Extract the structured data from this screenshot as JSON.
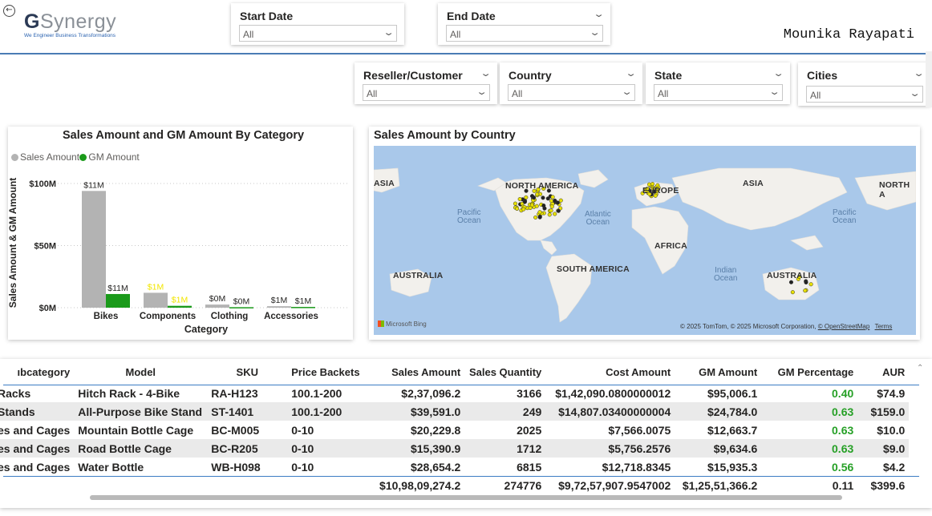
{
  "header": {
    "logo_initial": "G",
    "logo_rest": "Synergy",
    "logo_tagline": "We Engineer Business Transformations",
    "user_name": "Mounika Rayapati",
    "back_icon": "←"
  },
  "filters": {
    "start_date": {
      "title": "Start Date",
      "value": "All"
    },
    "end_date": {
      "title": "End Date",
      "value": "All"
    },
    "reseller": {
      "title": "Reseller/Customer",
      "value": "All"
    },
    "country": {
      "title": "Country",
      "value": "All"
    },
    "state": {
      "title": "State",
      "value": "All"
    },
    "cities": {
      "title": "Cities",
      "value": "All"
    }
  },
  "category_chart": {
    "title": "Sales Amount and GM Amount By Category",
    "legend": [
      {
        "name": "Sales Amount",
        "color": "#b3b3b3"
      },
      {
        "name": "GM Amount",
        "color": "#1a9a1a"
      }
    ],
    "xlabel": "Category",
    "ylabel": "Sales Amount & GM Amount",
    "y_ticks": [
      "$100M",
      "$50M",
      "$0M"
    ]
  },
  "chart_data": {
    "type": "bar",
    "categories": [
      "Bikes",
      "Components",
      "Clothing",
      "Accessories"
    ],
    "series": [
      {
        "name": "Sales Amount",
        "values": [
          94,
          12,
          2.5,
          1.2
        ],
        "labels": [
          "$11M",
          "$1M",
          "$0M",
          "$1M"
        ],
        "color": "#b3b3b3"
      },
      {
        "name": "GM Amount",
        "values": [
          11,
          1.5,
          0.4,
          0.6
        ],
        "labels": [
          "$11M",
          "$1M",
          "$0M",
          "$1M"
        ],
        "color": "#1a9a1a"
      }
    ],
    "highlight_label_color": "#f2e600",
    "xlabel": "Category",
    "ylabel": "Sales Amount & GM Amount",
    "ylim": [
      0,
      100
    ],
    "y_ticks": [
      0,
      50,
      100
    ],
    "grid": true,
    "legend": "top-left"
  },
  "map": {
    "title": "Sales Amount by Country",
    "continents": [
      "NORTH AMERICA",
      "EUROPE",
      "ASIA",
      "ASIA",
      "NORTH A",
      "AFRICA",
      "SOUTH AMERICA",
      "AUSTRALIA",
      "AUSTRALIA"
    ],
    "oceans": [
      {
        "line1": "Pacific",
        "line2": "Ocean"
      },
      {
        "line1": "Atlantic",
        "line2": "Ocean"
      },
      {
        "line1": "Pacific",
        "line2": "Ocean"
      },
      {
        "line1": "Indian",
        "line2": "Ocean"
      }
    ],
    "attribution_logo": "Microsoft Bing",
    "copyright": "© 2025 TomTom, © 2025 Microsoft Corporation,",
    "osm_link": "© OpenStreetMap",
    "terms_link": "Terms"
  },
  "table": {
    "columns": [
      "ıbcategory",
      "Model",
      "SKU",
      "Price Backets",
      "Sales Amount",
      "Sales Quantity",
      "Cost Amount",
      "GM Amount",
      "GM Percentage",
      "AUR"
    ],
    "rows": [
      [
        "Racks",
        "Hitch Rack - 4-Bike",
        "RA-H123",
        "100.1-200",
        "$2,37,096.2",
        "3166",
        "$1,42,090.0800000012",
        "$95,006.1",
        "0.40",
        "$74.9"
      ],
      [
        "Stands",
        "All-Purpose Bike Stand",
        "ST-1401",
        "100.1-200",
        "$39,591.0",
        "249",
        "$14,807.03400000004",
        "$24,784.0",
        "0.63",
        "$159.0"
      ],
      [
        "es and Cages",
        "Mountain Bottle Cage",
        "BC-M005",
        "0-10",
        "$20,229.8",
        "2025",
        "$7,566.0075",
        "$12,663.7",
        "0.63",
        "$10.0"
      ],
      [
        "es and Cages",
        "Road Bottle Cage",
        "BC-R205",
        "0-10",
        "$15,390.9",
        "1712",
        "$5,756.2576",
        "$9,634.6",
        "0.63",
        "$9.0"
      ],
      [
        "es and Cages",
        "Water Bottle",
        "WB-H098",
        "0-10",
        "$28,654.2",
        "6815",
        "$12,718.8345",
        "$15,935.3",
        "0.56",
        "$4.2"
      ]
    ],
    "totals": [
      "",
      "",
      "",
      "",
      "$10,98,09,274.2",
      "274776",
      "$9,72,57,907.9547002",
      "$1,25,51,366.2",
      "0.11",
      "$399.6"
    ]
  }
}
